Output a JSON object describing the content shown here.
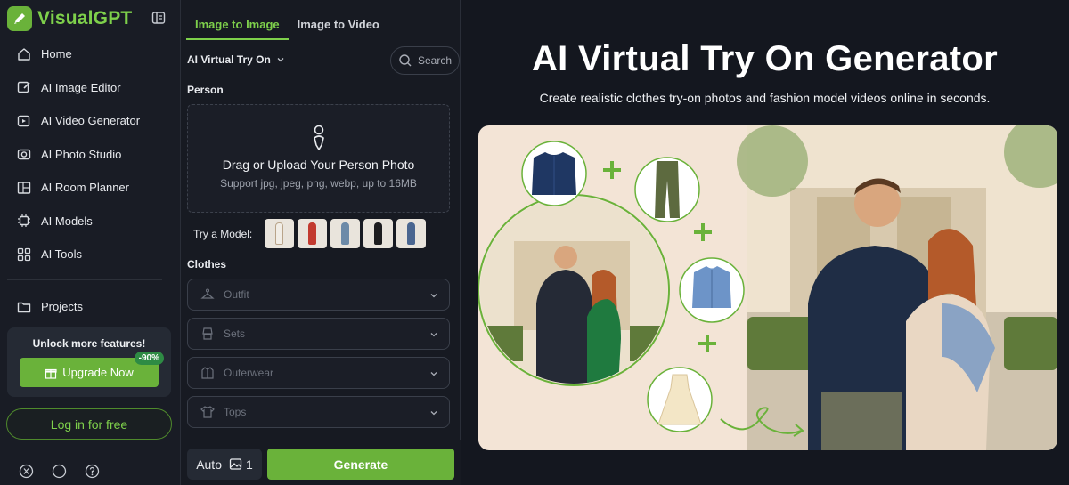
{
  "brand": {
    "name": "VisualGPT",
    "accent": "#7ed04b",
    "button": "#6ab23a"
  },
  "sidebar": {
    "items": [
      {
        "label": "Home",
        "icon": "home-icon"
      },
      {
        "label": "AI Image Editor",
        "icon": "image-edit-icon"
      },
      {
        "label": "AI Video Generator",
        "icon": "video-icon"
      },
      {
        "label": "AI Photo Studio",
        "icon": "camera-icon"
      },
      {
        "label": "AI Room Planner",
        "icon": "room-icon"
      },
      {
        "label": "AI Models",
        "icon": "chip-icon"
      },
      {
        "label": "AI Tools",
        "icon": "grid-icon"
      }
    ],
    "projects": "Projects",
    "upsell": {
      "title": "Unlock more features!",
      "button": "Upgrade Now",
      "badge": "-90%"
    },
    "login": "Log in for free"
  },
  "panel": {
    "tabs": [
      "Image to Image",
      "Image to Video"
    ],
    "model_select": "AI Virtual Try On",
    "search_placeholder": "Search",
    "person_label": "Person",
    "upload": {
      "title": "Drag or Upload Your Person Photo",
      "subtitle": "Support jpg, jpeg, png, webp, up to 16MB"
    },
    "try_model_label": "Try a Model:",
    "clothes_label": "Clothes",
    "clothes_options": [
      "Outfit",
      "Sets",
      "Outerwear",
      "Tops"
    ],
    "auto_label": "Auto",
    "image_count": "1",
    "generate": "Generate"
  },
  "hero": {
    "title": "AI Virtual Try On Generator",
    "subtitle": "Create realistic clothes try-on photos and fashion model videos online in seconds."
  }
}
